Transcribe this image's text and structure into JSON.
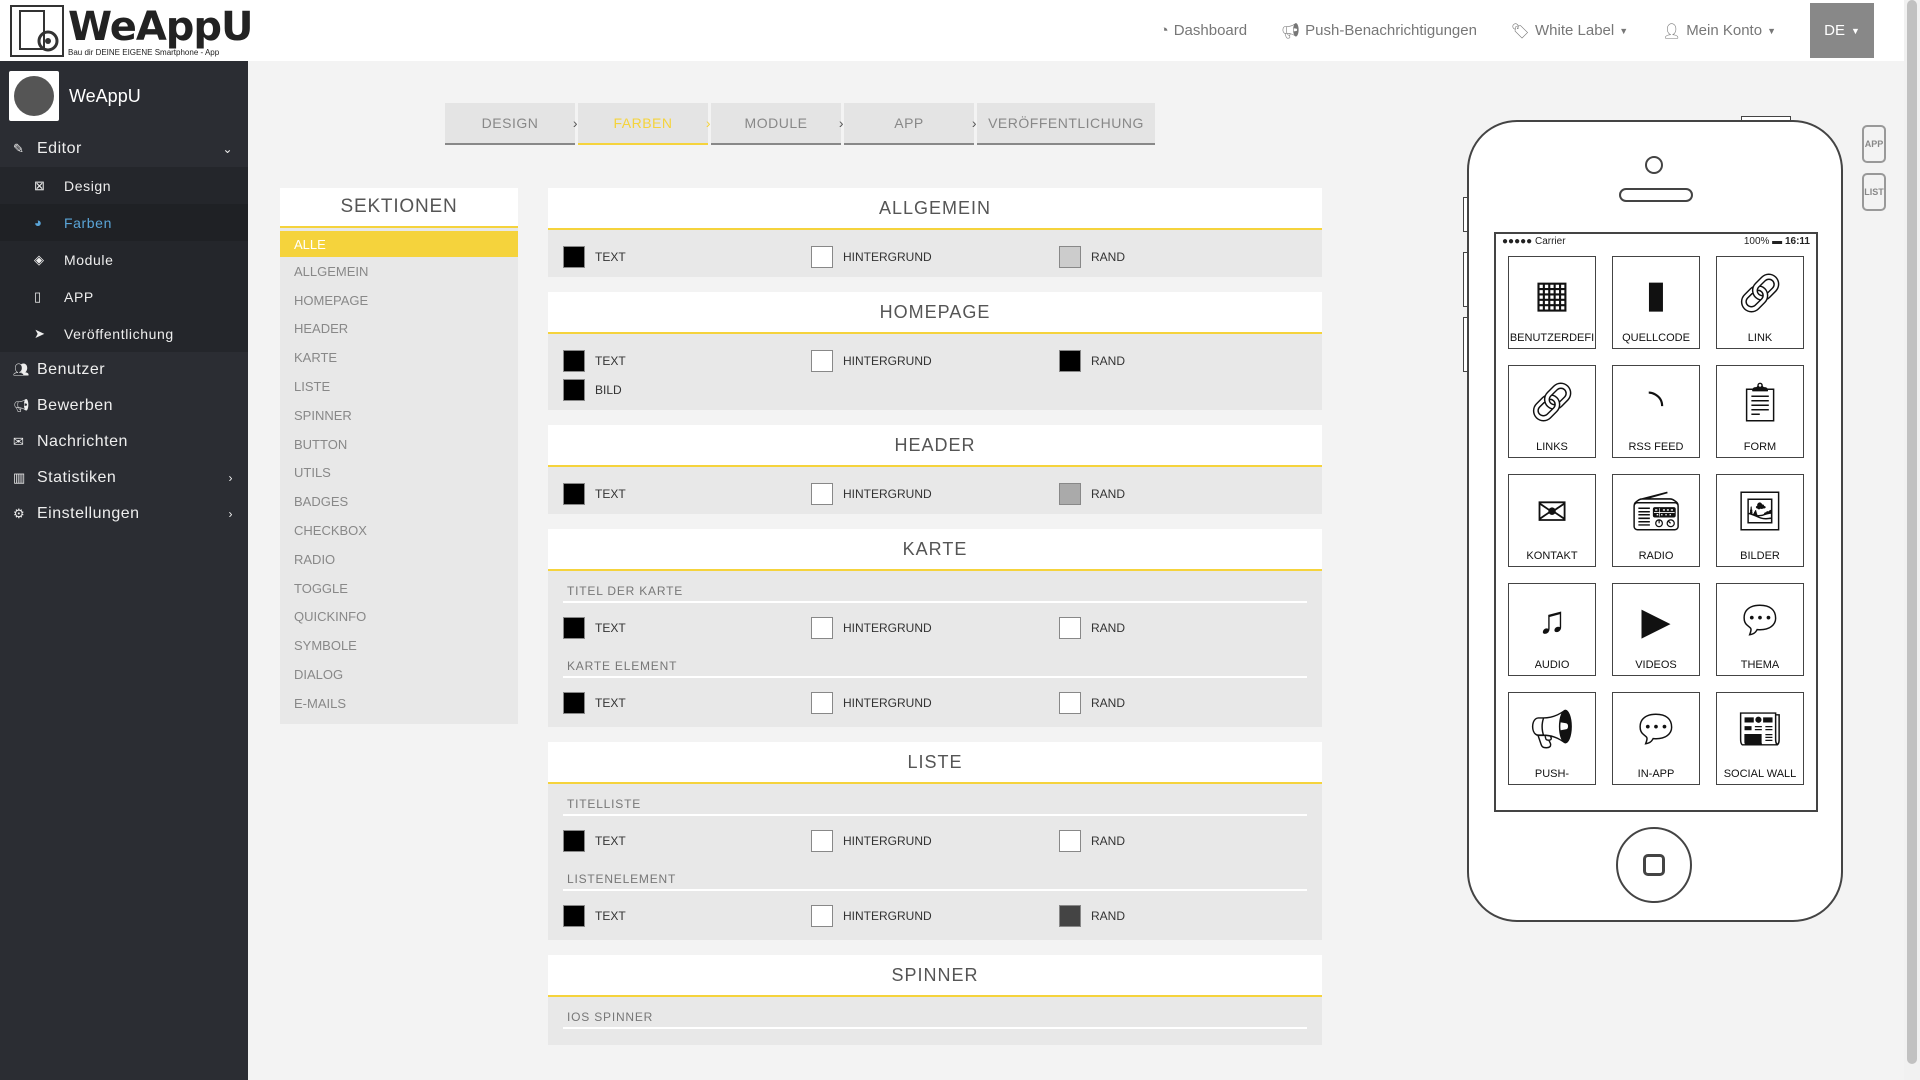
{
  "logo": {
    "text": "WeAppU",
    "sub": "Bau dir DEINE EIGENE Smartphone - App"
  },
  "topnav": {
    "dashboard": "Dashboard",
    "push": "Push-Benachrichtigungen",
    "whitelabel": "White Label",
    "account": "Mein Konto",
    "lang": "DE"
  },
  "sidebar": {
    "brand": "WeAppU",
    "editor": "Editor",
    "sub": [
      "Design",
      "Farben",
      "Module",
      "APP",
      "Veröffentlichung"
    ],
    "items": [
      "Benutzer",
      "Bewerben",
      "Nachrichten",
      "Statistiken",
      "Einstellungen"
    ]
  },
  "steps": [
    "DESIGN",
    "FARBEN",
    "MODULE",
    "APP",
    "VERÖFFENTLICHUNG"
  ],
  "sections": {
    "title": "SEKTIONEN",
    "items": [
      "ALLE",
      "ALLGEMEIN",
      "HOMEPAGE",
      "HEADER",
      "KARTE",
      "LISTE",
      "SPINNER",
      "BUTTON",
      "UTILS",
      "BADGES",
      "CHECKBOX",
      "RADIO",
      "TOGGLE",
      "QUICKINFO",
      "SYMBOLE",
      "DIALOG",
      "E-MAILS"
    ]
  },
  "labels": {
    "text": "TEXT",
    "bg": "HINTERGRUND",
    "rand": "RAND",
    "bild": "BILD"
  },
  "panels": {
    "allgemein": "ALLGEMEIN",
    "homepage": "HOMEPAGE",
    "header": "HEADER",
    "karte": "KARTE",
    "karte_sub1": "TITEL DER KARTE",
    "karte_sub2": "KARTE ELEMENT",
    "liste": "LISTE",
    "liste_sub1": "TITELLISTE",
    "liste_sub2": "LISTENELEMENT",
    "spinner": "SPINNER",
    "spinner_sub1": "IOS SPINNER"
  },
  "colors": {
    "black": "#000000",
    "white": "#ffffff",
    "lightgray": "#cccccc",
    "midgray": "#aaaaaa",
    "darkgray": "#444444",
    "accent": "#f5d33c"
  },
  "phone": {
    "carrier": "Carrier",
    "battery": "100%",
    "time": "16:11",
    "modules": [
      "BENUTZERDEFI",
      "QUELLCODE",
      "LINK",
      "LINKS",
      "RSS FEED",
      "FORM",
      "KONTAKT",
      "RADIO",
      "BILDER",
      "AUDIO",
      "VIDEOS",
      "THEMA",
      "PUSH-",
      "IN-APP",
      "SOCIAL WALL"
    ]
  },
  "side_tabs": [
    "APP",
    "LIST"
  ]
}
